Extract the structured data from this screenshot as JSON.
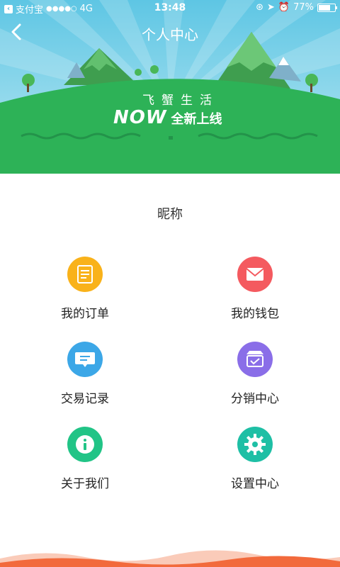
{
  "status_bar": {
    "back_app": "支付宝",
    "signal": "●●●●○",
    "network": "4G",
    "time": "13:48",
    "battery": "77%"
  },
  "header": {
    "title": "个人中心"
  },
  "banner": {
    "slogan_top": "飞蟹生活",
    "slogan_now": "NOW",
    "slogan_sub": "全新上线"
  },
  "profile": {
    "nickname": "昵称"
  },
  "menu": {
    "orders": {
      "label": "我的订单",
      "icon": "order-icon",
      "color": "#f9b21a"
    },
    "wallet": {
      "label": "我的钱包",
      "icon": "wallet-icon",
      "color": "#f45a5f"
    },
    "trades": {
      "label": "交易记录",
      "icon": "message-icon",
      "color": "#3ca7e7"
    },
    "distribution": {
      "label": "分销中心",
      "icon": "store-icon",
      "color": "#8a6ee8"
    },
    "about": {
      "label": "关于我们",
      "icon": "info-icon",
      "color": "#21c486"
    },
    "settings": {
      "label": "设置中心",
      "icon": "gear-icon",
      "color": "#1ebfa5"
    }
  },
  "colors": {
    "sky": "#5dc8e6",
    "grass": "#2db257",
    "accent_footer": "#f26a3c"
  }
}
